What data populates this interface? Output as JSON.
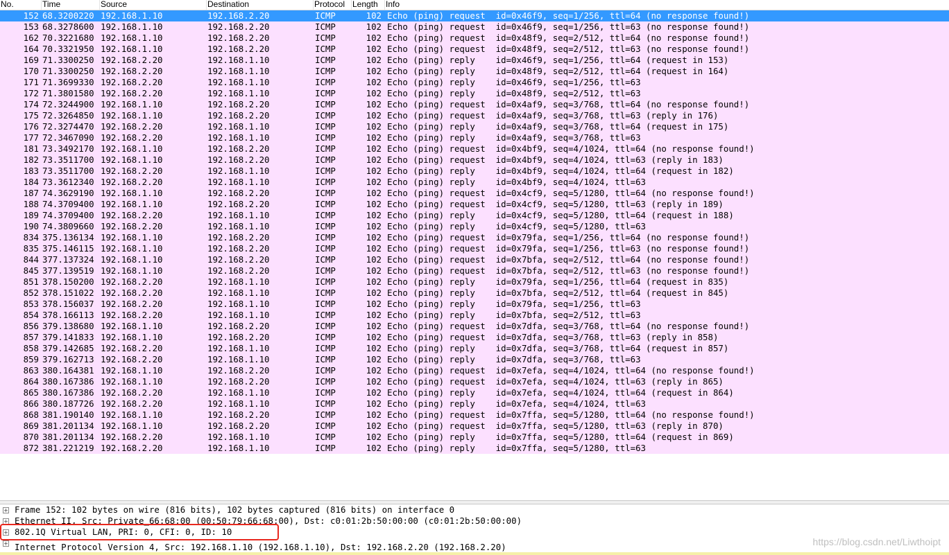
{
  "columns": {
    "no": "No.",
    "time": "Time",
    "source": "Source",
    "destination": "Destination",
    "protocol": "Protocol",
    "length": "Length",
    "info": "Info"
  },
  "packets": [
    {
      "no": "152",
      "time": "68.3200220",
      "src": "192.168.1.10",
      "dst": "192.168.2.20",
      "proto": "ICMP",
      "len": "102",
      "info": "Echo (ping) request  id=0x46f9, seq=1/256, ttl=64 (no response found!)"
    },
    {
      "no": "153",
      "time": "68.3278600",
      "src": "192.168.1.10",
      "dst": "192.168.2.20",
      "proto": "ICMP",
      "len": "102",
      "info": "Echo (ping) request  id=0x46f9, seq=1/256, ttl=63 (no response found!)"
    },
    {
      "no": "162",
      "time": "70.3221680",
      "src": "192.168.1.10",
      "dst": "192.168.2.20",
      "proto": "ICMP",
      "len": "102",
      "info": "Echo (ping) request  id=0x48f9, seq=2/512, ttl=64 (no response found!)"
    },
    {
      "no": "164",
      "time": "70.3321950",
      "src": "192.168.1.10",
      "dst": "192.168.2.20",
      "proto": "ICMP",
      "len": "102",
      "info": "Echo (ping) request  id=0x48f9, seq=2/512, ttl=63 (no response found!)"
    },
    {
      "no": "169",
      "time": "71.3300250",
      "src": "192.168.2.20",
      "dst": "192.168.1.10",
      "proto": "ICMP",
      "len": "102",
      "info": "Echo (ping) reply    id=0x46f9, seq=1/256, ttl=64 (request in 153)"
    },
    {
      "no": "170",
      "time": "71.3300250",
      "src": "192.168.2.20",
      "dst": "192.168.1.10",
      "proto": "ICMP",
      "len": "102",
      "info": "Echo (ping) reply    id=0x48f9, seq=2/512, ttl=64 (request in 164)"
    },
    {
      "no": "171",
      "time": "71.3699330",
      "src": "192.168.2.20",
      "dst": "192.168.1.10",
      "proto": "ICMP",
      "len": "102",
      "info": "Echo (ping) reply    id=0x46f9, seq=1/256, ttl=63"
    },
    {
      "no": "172",
      "time": "71.3801580",
      "src": "192.168.2.20",
      "dst": "192.168.1.10",
      "proto": "ICMP",
      "len": "102",
      "info": "Echo (ping) reply    id=0x48f9, seq=2/512, ttl=63"
    },
    {
      "no": "174",
      "time": "72.3244900",
      "src": "192.168.1.10",
      "dst": "192.168.2.20",
      "proto": "ICMP",
      "len": "102",
      "info": "Echo (ping) request  id=0x4af9, seq=3/768, ttl=64 (no response found!)"
    },
    {
      "no": "175",
      "time": "72.3264850",
      "src": "192.168.1.10",
      "dst": "192.168.2.20",
      "proto": "ICMP",
      "len": "102",
      "info": "Echo (ping) request  id=0x4af9, seq=3/768, ttl=63 (reply in 176)"
    },
    {
      "no": "176",
      "time": "72.3274470",
      "src": "192.168.2.20",
      "dst": "192.168.1.10",
      "proto": "ICMP",
      "len": "102",
      "info": "Echo (ping) reply    id=0x4af9, seq=3/768, ttl=64 (request in 175)"
    },
    {
      "no": "177",
      "time": "72.3467090",
      "src": "192.168.2.20",
      "dst": "192.168.1.10",
      "proto": "ICMP",
      "len": "102",
      "info": "Echo (ping) reply    id=0x4af9, seq=3/768, ttl=63"
    },
    {
      "no": "181",
      "time": "73.3492170",
      "src": "192.168.1.10",
      "dst": "192.168.2.20",
      "proto": "ICMP",
      "len": "102",
      "info": "Echo (ping) request  id=0x4bf9, seq=4/1024, ttl=64 (no response found!)"
    },
    {
      "no": "182",
      "time": "73.3511700",
      "src": "192.168.1.10",
      "dst": "192.168.2.20",
      "proto": "ICMP",
      "len": "102",
      "info": "Echo (ping) request  id=0x4bf9, seq=4/1024, ttl=63 (reply in 183)"
    },
    {
      "no": "183",
      "time": "73.3511700",
      "src": "192.168.2.20",
      "dst": "192.168.1.10",
      "proto": "ICMP",
      "len": "102",
      "info": "Echo (ping) reply    id=0x4bf9, seq=4/1024, ttl=64 (request in 182)"
    },
    {
      "no": "184",
      "time": "73.3612340",
      "src": "192.168.2.20",
      "dst": "192.168.1.10",
      "proto": "ICMP",
      "len": "102",
      "info": "Echo (ping) reply    id=0x4bf9, seq=4/1024, ttl=63"
    },
    {
      "no": "187",
      "time": "74.3629190",
      "src": "192.168.1.10",
      "dst": "192.168.2.20",
      "proto": "ICMP",
      "len": "102",
      "info": "Echo (ping) request  id=0x4cf9, seq=5/1280, ttl=64 (no response found!)"
    },
    {
      "no": "188",
      "time": "74.3709400",
      "src": "192.168.1.10",
      "dst": "192.168.2.20",
      "proto": "ICMP",
      "len": "102",
      "info": "Echo (ping) request  id=0x4cf9, seq=5/1280, ttl=63 (reply in 189)"
    },
    {
      "no": "189",
      "time": "74.3709400",
      "src": "192.168.2.20",
      "dst": "192.168.1.10",
      "proto": "ICMP",
      "len": "102",
      "info": "Echo (ping) reply    id=0x4cf9, seq=5/1280, ttl=64 (request in 188)"
    },
    {
      "no": "190",
      "time": "74.3809660",
      "src": "192.168.2.20",
      "dst": "192.168.1.10",
      "proto": "ICMP",
      "len": "102",
      "info": "Echo (ping) reply    id=0x4cf9, seq=5/1280, ttl=63"
    },
    {
      "no": "834",
      "time": "375.136134",
      "src": "192.168.1.10",
      "dst": "192.168.2.20",
      "proto": "ICMP",
      "len": "102",
      "info": "Echo (ping) request  id=0x79fa, seq=1/256, ttl=64 (no response found!)"
    },
    {
      "no": "835",
      "time": "375.146115",
      "src": "192.168.1.10",
      "dst": "192.168.2.20",
      "proto": "ICMP",
      "len": "102",
      "info": "Echo (ping) request  id=0x79fa, seq=1/256, ttl=63 (no response found!)"
    },
    {
      "no": "844",
      "time": "377.137324",
      "src": "192.168.1.10",
      "dst": "192.168.2.20",
      "proto": "ICMP",
      "len": "102",
      "info": "Echo (ping) request  id=0x7bfa, seq=2/512, ttl=64 (no response found!)"
    },
    {
      "no": "845",
      "time": "377.139519",
      "src": "192.168.1.10",
      "dst": "192.168.2.20",
      "proto": "ICMP",
      "len": "102",
      "info": "Echo (ping) request  id=0x7bfa, seq=2/512, ttl=63 (no response found!)"
    },
    {
      "no": "851",
      "time": "378.150200",
      "src": "192.168.2.20",
      "dst": "192.168.1.10",
      "proto": "ICMP",
      "len": "102",
      "info": "Echo (ping) reply    id=0x79fa, seq=1/256, ttl=64 (request in 835)"
    },
    {
      "no": "852",
      "time": "378.151022",
      "src": "192.168.2.20",
      "dst": "192.168.1.10",
      "proto": "ICMP",
      "len": "102",
      "info": "Echo (ping) reply    id=0x7bfa, seq=2/512, ttl=64 (request in 845)"
    },
    {
      "no": "853",
      "time": "378.156037",
      "src": "192.168.2.20",
      "dst": "192.168.1.10",
      "proto": "ICMP",
      "len": "102",
      "info": "Echo (ping) reply    id=0x79fa, seq=1/256, ttl=63"
    },
    {
      "no": "854",
      "time": "378.166113",
      "src": "192.168.2.20",
      "dst": "192.168.1.10",
      "proto": "ICMP",
      "len": "102",
      "info": "Echo (ping) reply    id=0x7bfa, seq=2/512, ttl=63"
    },
    {
      "no": "856",
      "time": "379.138680",
      "src": "192.168.1.10",
      "dst": "192.168.2.20",
      "proto": "ICMP",
      "len": "102",
      "info": "Echo (ping) request  id=0x7dfa, seq=3/768, ttl=64 (no response found!)"
    },
    {
      "no": "857",
      "time": "379.141833",
      "src": "192.168.1.10",
      "dst": "192.168.2.20",
      "proto": "ICMP",
      "len": "102",
      "info": "Echo (ping) request  id=0x7dfa, seq=3/768, ttl=63 (reply in 858)"
    },
    {
      "no": "858",
      "time": "379.142685",
      "src": "192.168.2.20",
      "dst": "192.168.1.10",
      "proto": "ICMP",
      "len": "102",
      "info": "Echo (ping) reply    id=0x7dfa, seq=3/768, ttl=64 (request in 857)"
    },
    {
      "no": "859",
      "time": "379.162713",
      "src": "192.168.2.20",
      "dst": "192.168.1.10",
      "proto": "ICMP",
      "len": "102",
      "info": "Echo (ping) reply    id=0x7dfa, seq=3/768, ttl=63"
    },
    {
      "no": "863",
      "time": "380.164381",
      "src": "192.168.1.10",
      "dst": "192.168.2.20",
      "proto": "ICMP",
      "len": "102",
      "info": "Echo (ping) request  id=0x7efa, seq=4/1024, ttl=64 (no response found!)"
    },
    {
      "no": "864",
      "time": "380.167386",
      "src": "192.168.1.10",
      "dst": "192.168.2.20",
      "proto": "ICMP",
      "len": "102",
      "info": "Echo (ping) request  id=0x7efa, seq=4/1024, ttl=63 (reply in 865)"
    },
    {
      "no": "865",
      "time": "380.167386",
      "src": "192.168.2.20",
      "dst": "192.168.1.10",
      "proto": "ICMP",
      "len": "102",
      "info": "Echo (ping) reply    id=0x7efa, seq=4/1024, ttl=64 (request in 864)"
    },
    {
      "no": "866",
      "time": "380.187726",
      "src": "192.168.2.20",
      "dst": "192.168.1.10",
      "proto": "ICMP",
      "len": "102",
      "info": "Echo (ping) reply    id=0x7efa, seq=4/1024, ttl=63"
    },
    {
      "no": "868",
      "time": "381.190140",
      "src": "192.168.1.10",
      "dst": "192.168.2.20",
      "proto": "ICMP",
      "len": "102",
      "info": "Echo (ping) request  id=0x7ffa, seq=5/1280, ttl=64 (no response found!)"
    },
    {
      "no": "869",
      "time": "381.201134",
      "src": "192.168.1.10",
      "dst": "192.168.2.20",
      "proto": "ICMP",
      "len": "102",
      "info": "Echo (ping) request  id=0x7ffa, seq=5/1280, ttl=63 (reply in 870)"
    },
    {
      "no": "870",
      "time": "381.201134",
      "src": "192.168.2.20",
      "dst": "192.168.1.10",
      "proto": "ICMP",
      "len": "102",
      "info": "Echo (ping) reply    id=0x7ffa, seq=5/1280, ttl=64 (request in 869)"
    },
    {
      "no": "872",
      "time": "381.221219",
      "src": "192.168.2.20",
      "dst": "192.168.1.10",
      "proto": "ICMP",
      "len": "102",
      "info": "Echo (ping) reply    id=0x7ffa, seq=5/1280, ttl=63"
    }
  ],
  "details": [
    {
      "expander": "+",
      "text": "Frame 152: 102 bytes on wire (816 bits), 102 bytes captured (816 bits) on interface 0"
    },
    {
      "expander": "+",
      "text": "Ethernet II, Src: Private_66:68:00 (00:50:79:66:68:00), Dst: c0:01:2b:50:00:00 (c0:01:2b:50:00:00)"
    },
    {
      "expander": "+",
      "text": "802.1Q Virtual LAN, PRI: 0, CFI: 0, ID: 10"
    },
    {
      "expander": "+",
      "text": "Internet Protocol Version 4, Src: 192.168.1.10 (192.168.1.10), Dst: 192.168.2.20 (192.168.2.20)"
    }
  ],
  "watermark": "https://blog.csdn.net/Liwthoipt",
  "colors": {
    "row_bg": "#fce0ff",
    "selected_bg": "#3399ff",
    "highlight": "#e8281e"
  }
}
